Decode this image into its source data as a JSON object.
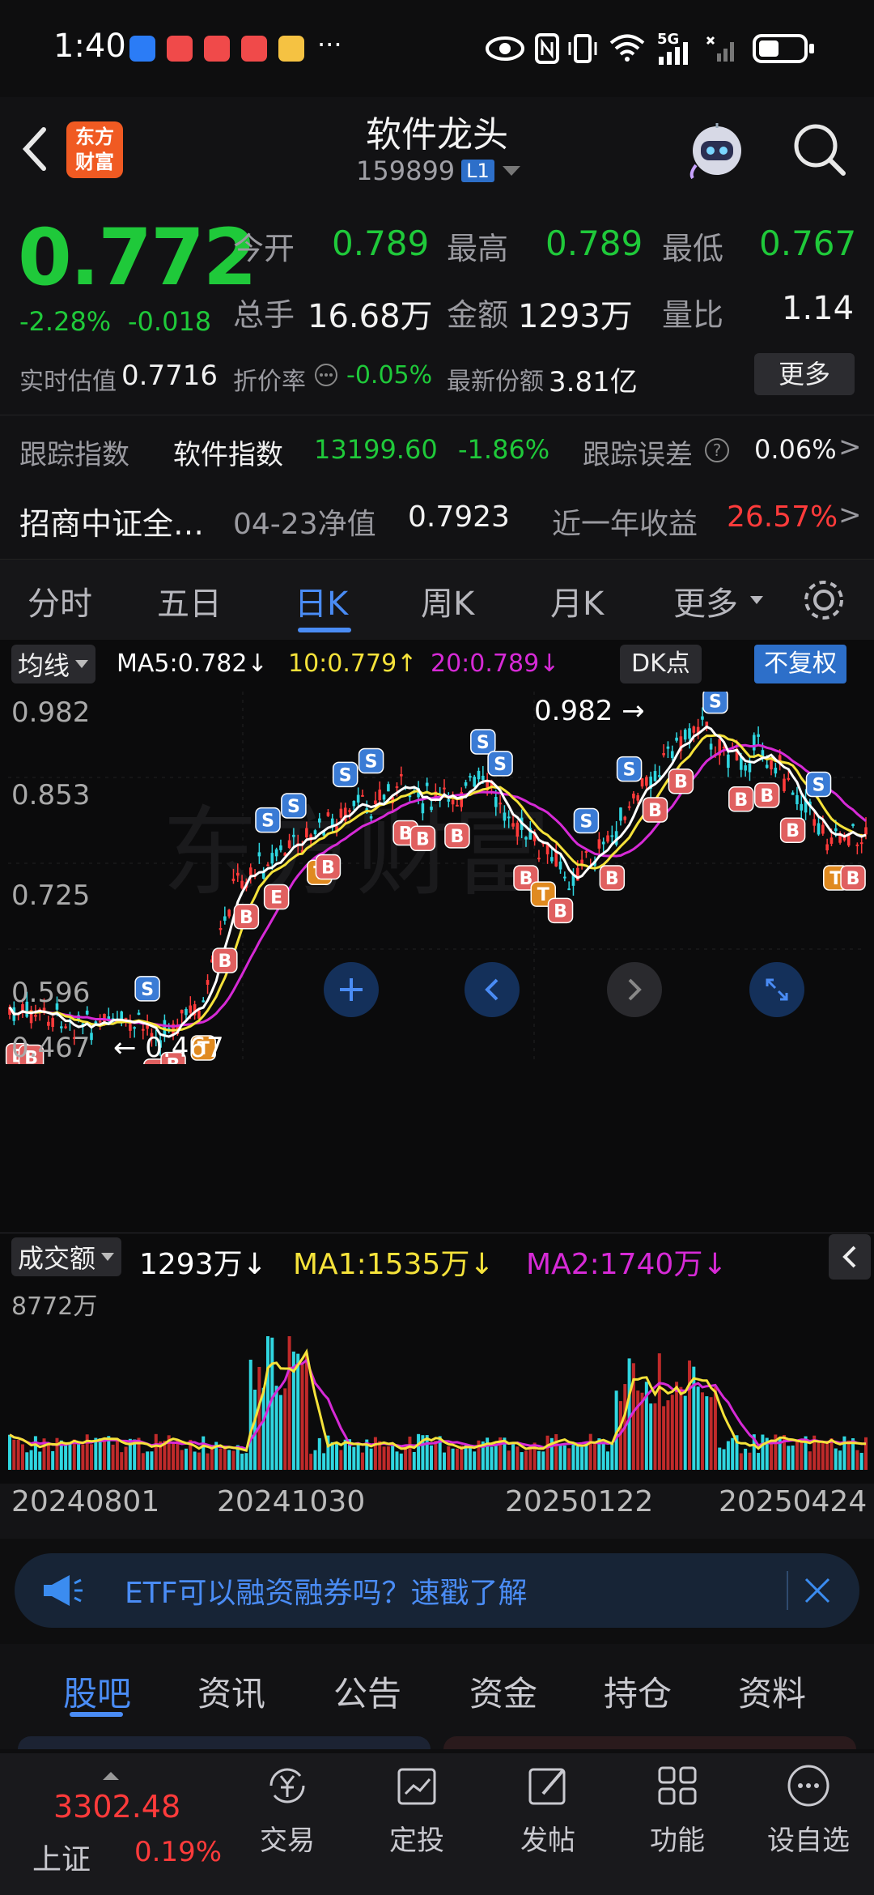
{
  "status_bar": {
    "time": "1:40",
    "more": "···",
    "network": "5G",
    "app_icons": [
      "alipay-icon",
      "red-book-icon",
      "red-book-icon",
      "red-book-icon",
      "weibo-icon"
    ],
    "right_icons": [
      "eye-icon",
      "nfc-icon",
      "vibrate-icon",
      "wifi-icon",
      "signal-icon",
      "signal-icon",
      "battery-icon"
    ]
  },
  "header": {
    "logo_line1": "东方",
    "logo_line2": "财富",
    "title": "软件龙头",
    "code": "159899",
    "level_badge": "L1"
  },
  "quote": {
    "price": "0.772",
    "change_pct": "-2.28%",
    "change_abs": "-0.018",
    "open_label": "今开",
    "open": "0.789",
    "high_label": "最高",
    "high": "0.789",
    "low_label": "最低",
    "low": "0.767",
    "volume_label": "总手",
    "volume": "16.68万",
    "amount_label": "金额",
    "amount": "1293万",
    "ratio_label": "量比",
    "ratio": "1.14",
    "estimate_label": "实时估值",
    "estimate": "0.7716",
    "discount_label": "折价率",
    "discount": "-0.05%",
    "shares_label": "最新份额",
    "shares": "3.81亿",
    "more_button": "更多",
    "track_label": "跟踪指数",
    "track_index": "软件指数",
    "track_value": "13199.60",
    "track_change": "-1.86%",
    "track_error_label": "跟踪误差",
    "track_error": "0.06%",
    "fund_name": "招商中证全…",
    "nav_label": "04-23净值",
    "nav": "0.7923",
    "year_return_label": "近一年收益",
    "year_return": "26.57%"
  },
  "k_tabs": [
    "分时",
    "五日",
    "日K",
    "周K",
    "月K",
    "更多"
  ],
  "k_tab_active": "日K",
  "indicator_bar": {
    "ma_select": "均线",
    "ma5": "MA5:0.782↓",
    "ma10": "10:0.779↑",
    "ma20": "20:0.789↓",
    "dk_button": "DK点",
    "adjust_button": "不复权"
  },
  "price_axis": [
    "0.982",
    "0.853",
    "0.725",
    "0.596",
    "0.467"
  ],
  "annotations": {
    "max": "0.982",
    "min": "0.467"
  },
  "volume_bar": {
    "select": "成交额",
    "current": "1293万↓",
    "ma1": "MA1:1535万↓",
    "ma2": "MA2:1740万↓",
    "max_label": "8772万"
  },
  "dates": [
    "20240801",
    "20241030",
    "20250122",
    "20250424"
  ],
  "banner": {
    "text": "ETF可以融资融券吗？速戳了解"
  },
  "bottom_tabs": [
    "股吧",
    "资讯",
    "公告",
    "资金",
    "持仓",
    "资料"
  ],
  "bottom_tab_active": "股吧",
  "index_ticker": {
    "value": "3302.48",
    "name": "上证",
    "change": "0.19%"
  },
  "nav": [
    {
      "label": "交易",
      "icon": "yuan-exchange-icon"
    },
    {
      "label": "定投",
      "icon": "chart-calendar-icon"
    },
    {
      "label": "发帖",
      "icon": "edit-post-icon"
    },
    {
      "label": "功能",
      "icon": "grid-apps-icon"
    },
    {
      "label": "设自选",
      "icon": "more-dots-icon"
    }
  ],
  "colors": {
    "up": "#ff3b3b",
    "down": "#1fc93a",
    "accent": "#3b8cf0",
    "ma5": "#ffffff",
    "ma10": "#f5e23a",
    "ma20": "#d62ad6",
    "cyan": "#2fd6e0"
  }
}
